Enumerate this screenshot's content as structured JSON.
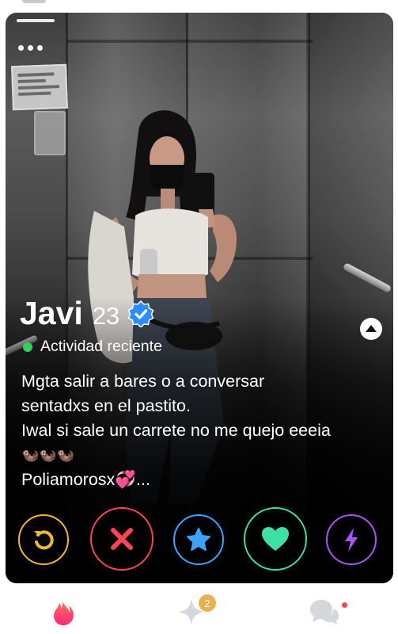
{
  "profile": {
    "name": "Javi",
    "age": "23",
    "activity": "Actividad reciente",
    "bio_lines": [
      "Mgta salir a bares o a conversar",
      "sentadxs en el pastito.",
      "Iwal si sale un carrete no me quejo eeeia",
      "🦦🦦🦦",
      "Poliamorosx💞..."
    ]
  },
  "icons": {
    "more": "more-dots-icon",
    "verified": "verified-check-icon",
    "expand": "chevron-up-icon",
    "rewind": "rewind-icon",
    "nope": "close-x-icon",
    "super_like": "star-icon",
    "like": "heart-icon",
    "boost": "lightning-bolt-icon",
    "tab_home": "flame-icon",
    "tab_gold": "sparkle-icon",
    "tab_messages": "chat-bubbles-icon"
  },
  "tabbar": {
    "gold_badge_count": "2"
  },
  "colors": {
    "rewind": "#f5b731",
    "nope": "#ff4458",
    "super_like": "#3ca4ff",
    "like": "#3fe0a6",
    "boost": "#a855f7",
    "online": "#34d058",
    "brand": "#fd5068"
  }
}
